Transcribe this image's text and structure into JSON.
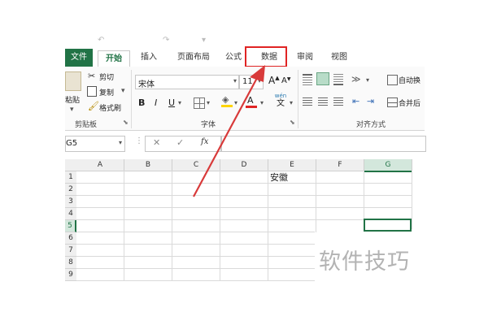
{
  "tabs": {
    "file": "文件",
    "home": "开始",
    "insert": "插入",
    "layout": "页面布局",
    "formulas": "公式",
    "data": "数据",
    "review": "审阅",
    "view": "视图"
  },
  "clipboard": {
    "paste_partial": "粘贴",
    "cut": "剪切",
    "copy": "复制",
    "format_painter": "格式刷",
    "group_label": "剪贴板"
  },
  "font": {
    "name": "宋体",
    "size": "11",
    "grow": "A",
    "shrink": "A",
    "bold": "B",
    "italic": "I",
    "underline": "U",
    "phonetic": "wén",
    "phonetic_char": "文",
    "font_color": "A",
    "group_label": "字体"
  },
  "alignment": {
    "wrap_partial": "自动换",
    "merge_partial": "合并后",
    "group_label": "对齐方式"
  },
  "formula_bar": {
    "name_box": "G5",
    "fx": "fx"
  },
  "sheet": {
    "columns": [
      "A",
      "B",
      "C",
      "D",
      "E",
      "F",
      "G"
    ],
    "rows": [
      "1",
      "2",
      "3",
      "4",
      "5",
      "6",
      "7",
      "8",
      "9"
    ],
    "cell_e1": "安徽",
    "selected_cell": "G5"
  },
  "watermark": "软件技巧",
  "colors": {
    "excel_green": "#217346",
    "highlight_red": "#e02424",
    "arrow_red": "#d83a3a"
  }
}
